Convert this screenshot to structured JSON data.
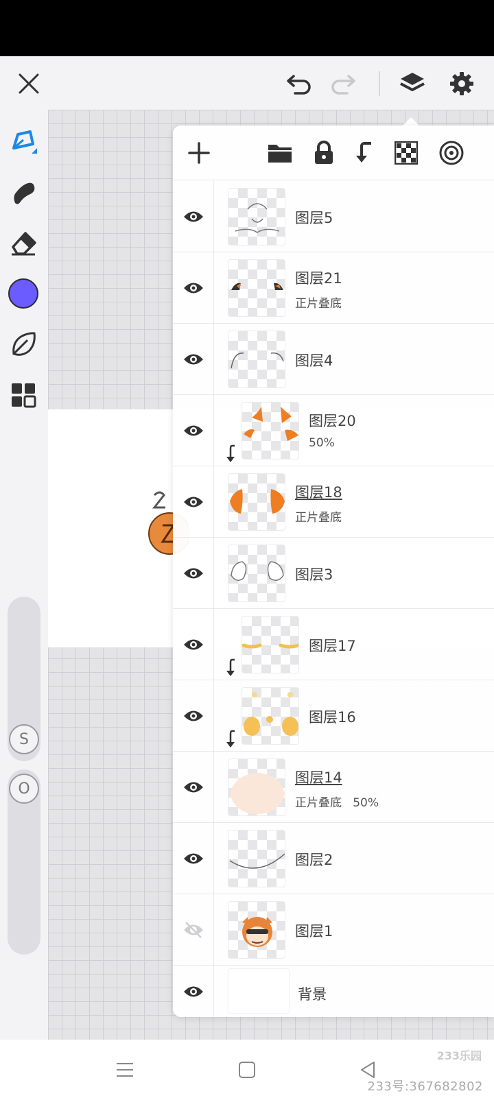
{
  "colors": {
    "accent": "#1e88e5",
    "current_brush": "#6b5cff",
    "icon": "#333333"
  },
  "topbar": {
    "close_icon": "close-icon",
    "undo_icon": "undo-icon",
    "redo_icon": "redo-icon",
    "layers_icon": "layers-icon",
    "settings_icon": "gear-icon"
  },
  "tools": [
    {
      "name": "brush-tool",
      "icon": "pen-icon"
    },
    {
      "name": "smudge-tool",
      "icon": "smudge-icon"
    },
    {
      "name": "eraser-tool",
      "icon": "eraser-icon"
    },
    {
      "name": "color-tool",
      "icon": "color-swatch"
    },
    {
      "name": "texture-tool",
      "icon": "leaf-icon"
    },
    {
      "name": "grid-tool",
      "icon": "grid-icon"
    }
  ],
  "sliders": {
    "size_label": "S",
    "opacity_label": "O"
  },
  "panel": {
    "header_icons": [
      "add-icon",
      "folder-icon",
      "lock-icon",
      "clip-icon",
      "checker-icon",
      "target-icon"
    ],
    "layers": [
      {
        "name": "图层5",
        "mode": "",
        "visible": true,
        "clipped": false,
        "underlined": false
      },
      {
        "name": "图层21",
        "mode": "正片叠底",
        "visible": true,
        "clipped": false,
        "underlined": false
      },
      {
        "name": "图层4",
        "mode": "",
        "visible": true,
        "clipped": false,
        "underlined": false
      },
      {
        "name": "图层20",
        "mode": "50%",
        "visible": true,
        "clipped": true,
        "underlined": false
      },
      {
        "name": "图层18",
        "mode": "正片叠底",
        "visible": true,
        "clipped": false,
        "underlined": true
      },
      {
        "name": "图层3",
        "mode": "",
        "visible": true,
        "clipped": false,
        "underlined": false
      },
      {
        "name": "图层17",
        "mode": "",
        "visible": true,
        "clipped": true,
        "underlined": false
      },
      {
        "name": "图层16",
        "mode": "",
        "visible": true,
        "clipped": true,
        "underlined": false
      },
      {
        "name": "图层14",
        "mode": "正片叠底   50%",
        "visible": true,
        "clipped": false,
        "underlined": true
      },
      {
        "name": "图层2",
        "mode": "",
        "visible": true,
        "clipped": false,
        "underlined": false
      },
      {
        "name": "图层1",
        "mode": "",
        "visible": false,
        "clipped": false,
        "underlined": false
      },
      {
        "name": "背景",
        "mode": "",
        "visible": true,
        "clipped": false,
        "underlined": false
      }
    ]
  },
  "navbar": {
    "watermark": "233号:367682802",
    "logo_text": "233乐园"
  }
}
